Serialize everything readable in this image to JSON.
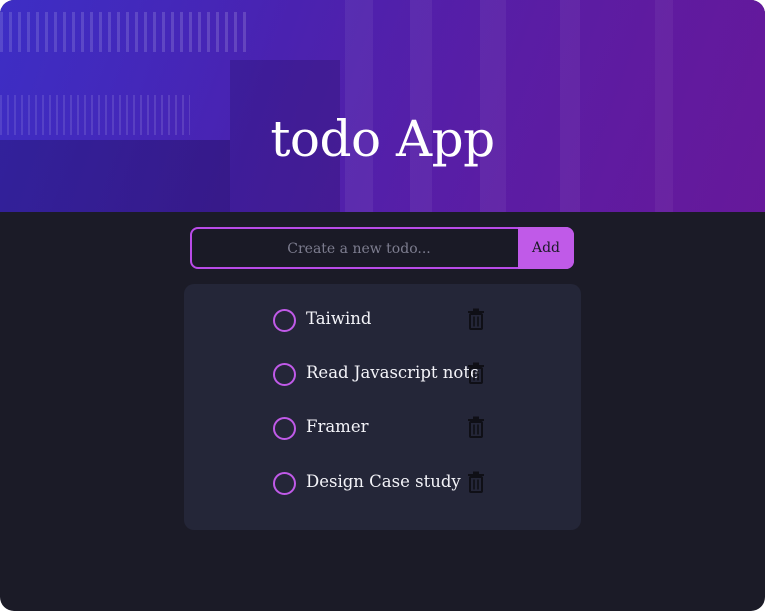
{
  "header": {
    "title": "todo App"
  },
  "new_todo": {
    "placeholder": "Create a new todo...",
    "value": "",
    "add_label": "Add"
  },
  "todos": [
    {
      "label": "Taiwind",
      "completed": false
    },
    {
      "label": "Read Javascript note",
      "completed": false
    },
    {
      "label": "Framer",
      "completed": false
    },
    {
      "label": "Design Case study",
      "completed": false
    }
  ],
  "icons": {
    "checkbox": "circle-checkbox-icon",
    "delete": "trash-icon"
  },
  "colors": {
    "accent": "#c05ae8",
    "background": "#1b1b27",
    "card": "#242638",
    "text": "#f3f3f8",
    "header_gradient_start": "#3d2fc4",
    "header_gradient_end": "#6a1a9c"
  }
}
